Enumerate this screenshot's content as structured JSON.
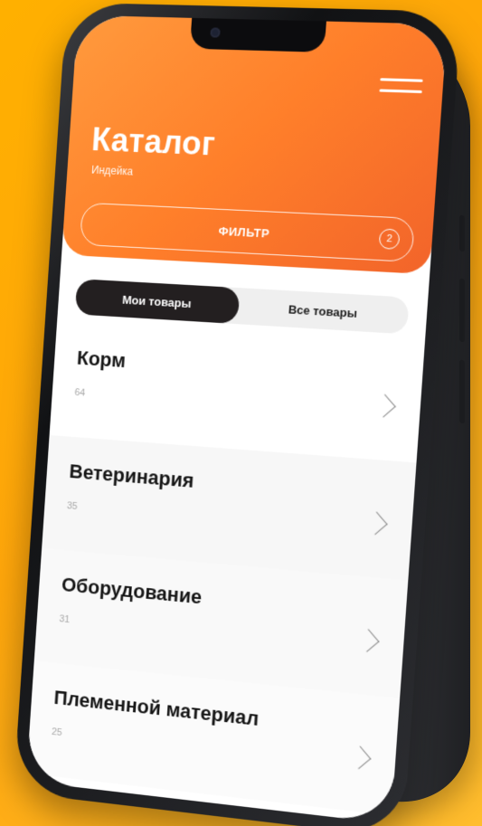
{
  "header": {
    "title": "Каталог",
    "subtitle": "Индейка",
    "filter_label": "ФИЛЬТР",
    "filter_count": "2"
  },
  "tabs": [
    {
      "label": "Мои товары",
      "active": true
    },
    {
      "label": "Все товары",
      "active": false
    }
  ],
  "categories": [
    {
      "title": "Корм",
      "count": "64"
    },
    {
      "title": "Ветеринария",
      "count": "35"
    },
    {
      "title": "Оборудование",
      "count": "31"
    },
    {
      "title": "Племенной материал",
      "count": "25"
    }
  ],
  "colors": {
    "background": "#ffa60a",
    "header_gradient_start": "#ff9a3d",
    "header_gradient_end": "#f2642a",
    "active_tab": "#231f20"
  },
  "icons": [
    "hamburger-menu-icon",
    "chevron-right-icon",
    "front-camera-icon"
  ]
}
